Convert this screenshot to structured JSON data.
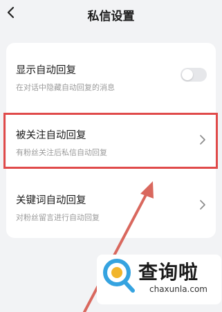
{
  "header": {
    "title": "私信设置"
  },
  "settings": {
    "items": [
      {
        "label": "显示自动回复",
        "sub": "在对话中隐藏自动回复的消息",
        "control": "toggle",
        "toggle_on": false
      },
      {
        "label": "被关注自动回复",
        "sub": "有粉丝关注后私信自动回复",
        "control": "chevron"
      },
      {
        "label": "关键词自动回复",
        "sub": "对粉丝留言进行自动回复",
        "control": "chevron"
      }
    ]
  },
  "watermark": {
    "title": "查询啦",
    "url": "chaxunla.com"
  },
  "colors": {
    "highlight": "#e04a4a",
    "arrow": "#d9685e",
    "background": "#f2f3f5"
  }
}
